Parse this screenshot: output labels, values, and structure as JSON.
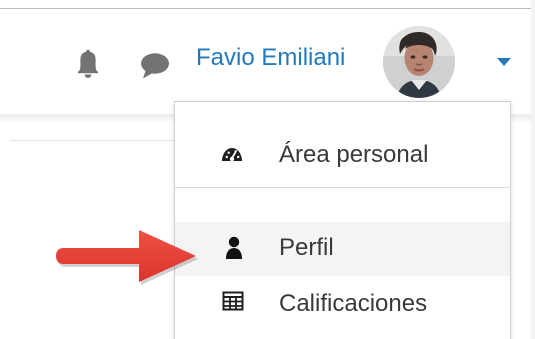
{
  "header": {
    "user_name": "Favio Emiliani",
    "icons": {
      "notifications": "bell-icon",
      "messages": "message-bubble-icon",
      "menu_toggle": "caret-down-icon"
    },
    "colors": {
      "user_name": "#2279bd",
      "icons": "#737373"
    }
  },
  "menu": {
    "items": [
      {
        "label": "Área personal",
        "icon": "dashboard-icon"
      },
      {
        "label": "Perfil",
        "icon": "user-icon",
        "highlighted": true
      },
      {
        "label": "Calificaciones",
        "icon": "table-icon"
      }
    ],
    "colors": {
      "text": "#373a3c",
      "highlight": "#f4f4f4"
    }
  },
  "annotation": {
    "type": "arrow",
    "color": "#e53935",
    "points_to": "Perfil"
  }
}
